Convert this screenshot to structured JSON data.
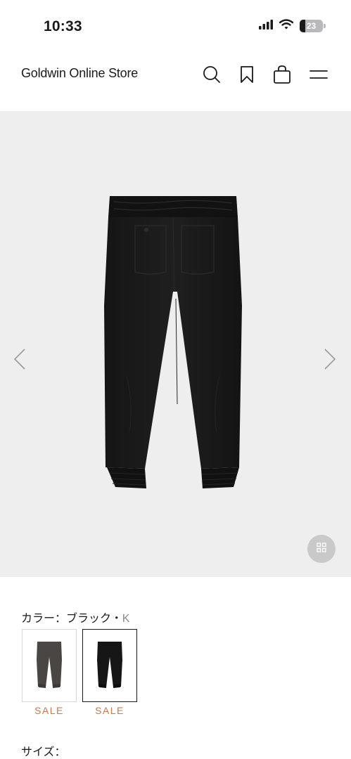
{
  "status_bar": {
    "time": "10:33",
    "battery_level": "23",
    "icons": [
      "signal-icon",
      "wifi-icon",
      "battery-icon"
    ]
  },
  "header": {
    "title": "Goldwin Online Store",
    "icons": [
      "search-icon",
      "bookmark-icon",
      "shopping-bag-icon",
      "menu-icon"
    ]
  },
  "gallery": {
    "background_color": "#eeeeee",
    "icons": [
      "chevron-left-icon",
      "chevron-right-icon",
      "grid-icon"
    ]
  },
  "color_section": {
    "label": "カラー：",
    "selected_color": "ブラック",
    "separator": "・",
    "selected_code": "K",
    "swatches": [
      {
        "name": "charcoal",
        "badge": "SALE",
        "selected": false
      },
      {
        "name": "black",
        "badge": "SALE",
        "selected": true
      }
    ],
    "sale_color": "#c8784b"
  },
  "size_section": {
    "label": "サイズ："
  }
}
